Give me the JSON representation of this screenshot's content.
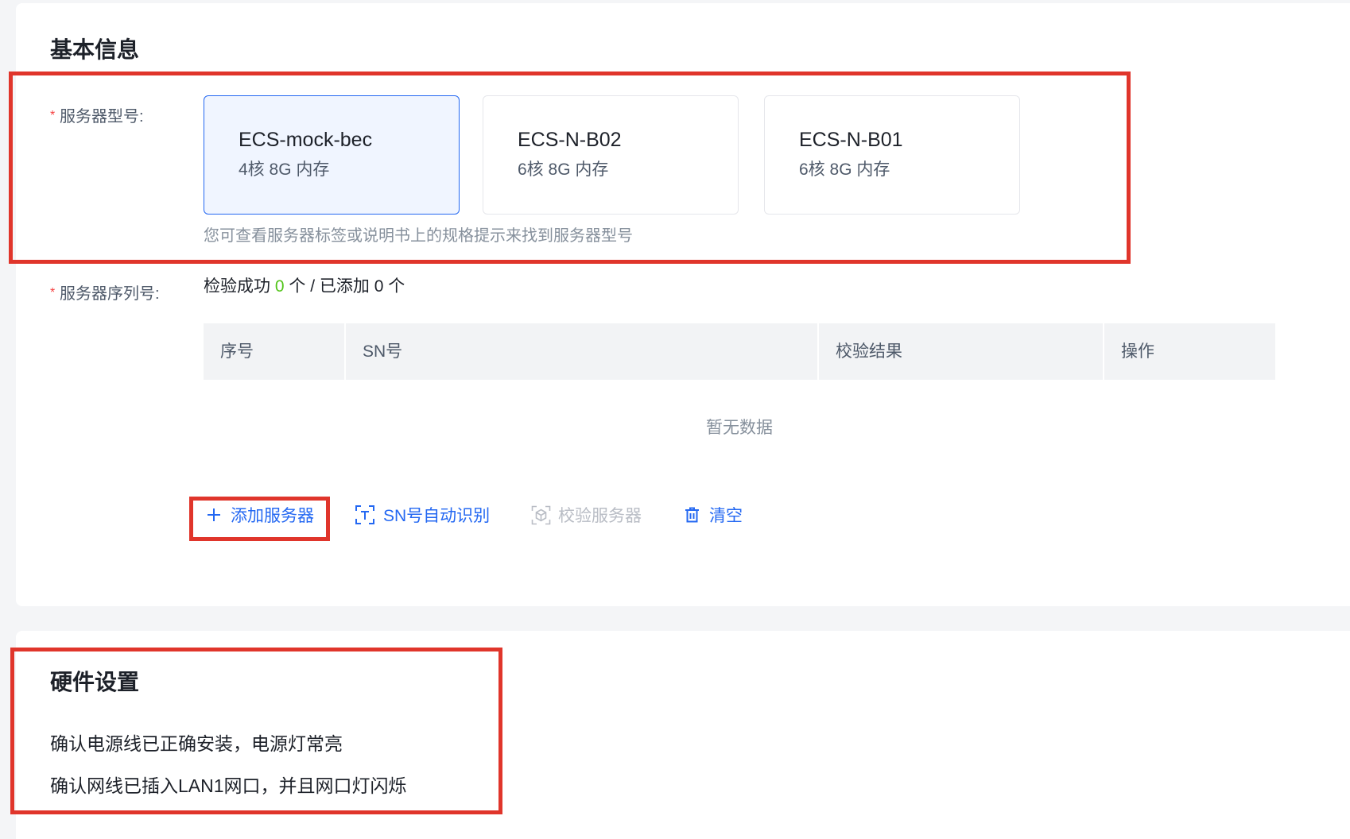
{
  "section_basic": {
    "title": "基本信息"
  },
  "server_model": {
    "required_mark": "*",
    "label": "服务器型号:",
    "options": [
      {
        "name": "ECS-mock-bec",
        "spec": "4核 8G 内存",
        "selected": true
      },
      {
        "name": "ECS-N-B02",
        "spec": "6核 8G 内存",
        "selected": false
      },
      {
        "name": "ECS-N-B01",
        "spec": "6核 8G 内存",
        "selected": false
      }
    ],
    "hint": "您可查看服务器标签或说明书上的规格提示来找到服务器型号"
  },
  "server_serial": {
    "required_mark": "*",
    "label": "服务器序列号:",
    "summary": {
      "prefix": "检验成功",
      "success_count": "0",
      "middle": "个 / 已添加",
      "added_count": "0",
      "suffix": "个"
    }
  },
  "table": {
    "columns": [
      "序号",
      "SN号",
      "校验结果",
      "操作"
    ],
    "rows": [],
    "empty_text": "暂无数据"
  },
  "actions": {
    "add": {
      "label": "添加服务器",
      "icon": "plus-icon",
      "enabled": true
    },
    "sn_recognize": {
      "label": "SN号自动识别",
      "icon": "scan-text-icon",
      "enabled": true
    },
    "verify": {
      "label": "校验服务器",
      "icon": "cube-scan-icon",
      "enabled": false
    },
    "clear": {
      "label": "清空",
      "icon": "trash-icon",
      "enabled": true
    }
  },
  "section_hardware": {
    "title": "硬件设置",
    "items": [
      "确认电源线已正确安装，电源灯常亮",
      "确认网线已插入LAN1网口，并且网口灯闪烁"
    ]
  },
  "colors": {
    "accent": "#2468f2",
    "required": "#f53f3f",
    "success": "#52c41a",
    "highlight": "#e0352b",
    "disabled": "#b9bdc5"
  }
}
